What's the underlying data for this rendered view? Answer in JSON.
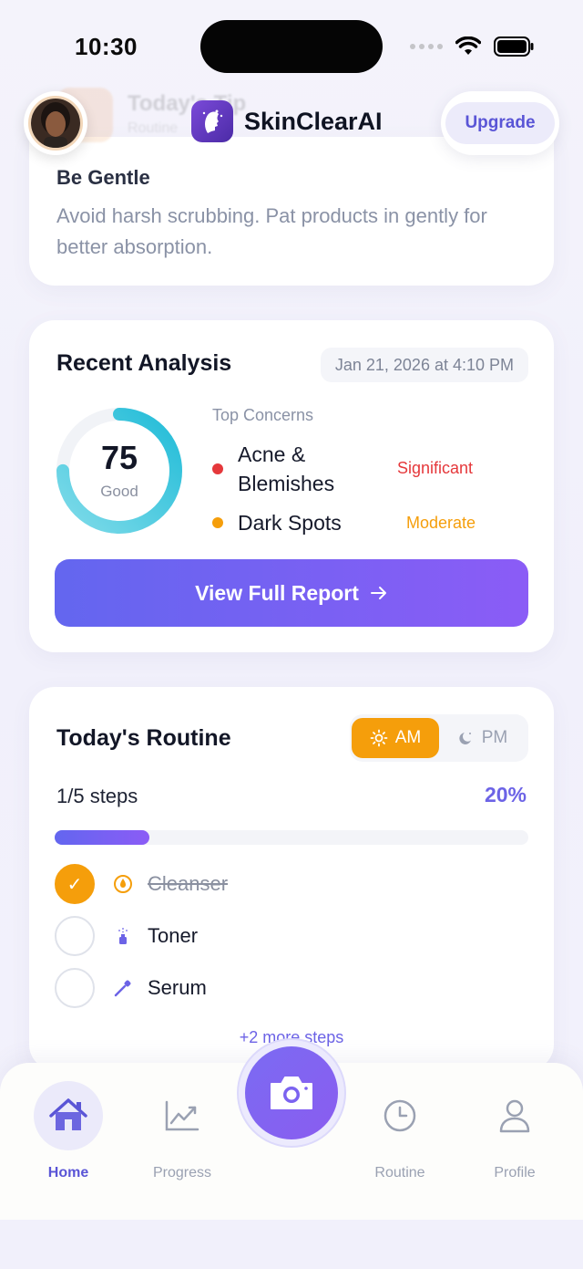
{
  "status_bar": {
    "time": "10:30"
  },
  "header": {
    "brand_name": "SkinClearAI",
    "upgrade_label": "Upgrade",
    "ghost_title": "Today's Tip",
    "ghost_subtitle": "Routine"
  },
  "tip": {
    "title": "Be Gentle",
    "body": "Avoid harsh scrubbing. Pat products in gently for better absorption."
  },
  "analysis": {
    "title": "Recent Analysis",
    "date": "Jan 21, 2026 at 4:10 PM",
    "score": "75",
    "score_label": "Good",
    "score_fraction": 0.75,
    "concerns_heading": "Top Concerns",
    "concerns": [
      {
        "name": "Acne & Blemishes",
        "level": "Significant",
        "color": "#e5383b"
      },
      {
        "name": "Dark Spots",
        "level": "Moderate",
        "color": "#f59e0b"
      }
    ],
    "report_button": "View Full Report"
  },
  "routine": {
    "title": "Today's Routine",
    "am_label": "AM",
    "pm_label": "PM",
    "steps_text": "1/5 steps",
    "percent": "20%",
    "progress_fraction": 0.2,
    "steps": [
      {
        "label": "Cleanser",
        "done": true,
        "icon": "droplet-icon"
      },
      {
        "label": "Toner",
        "done": false,
        "icon": "spray-icon"
      },
      {
        "label": "Serum",
        "done": false,
        "icon": "dropper-icon"
      }
    ],
    "more_steps": "+2 more steps"
  },
  "tabbar": {
    "home": "Home",
    "progress": "Progress",
    "routine": "Routine",
    "profile": "Profile"
  },
  "colors": {
    "accent": "#6366ef",
    "am_orange": "#f59e0b",
    "ring_cyan": "#38c6df"
  }
}
